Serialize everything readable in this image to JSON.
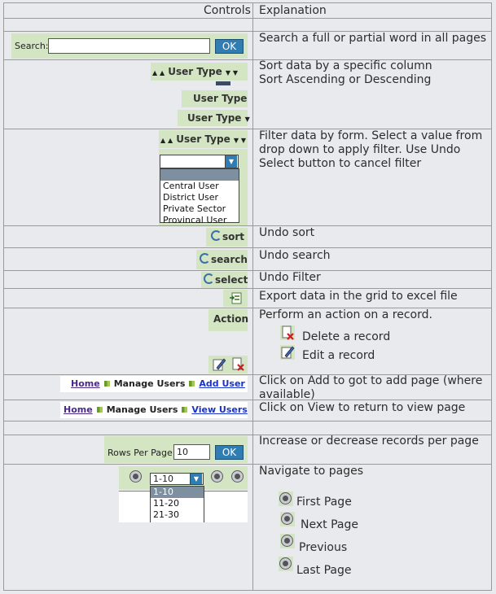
{
  "header": {
    "controls": "Controls",
    "explanation": "Explanation"
  },
  "search": {
    "label": "Search:",
    "value": "",
    "ok": "OK",
    "explanation": "Search a full or partial word in all pages"
  },
  "sort": {
    "column": "User Type",
    "explanation_1": "Sort data by a specific column",
    "explanation_2": "Sort Ascending or Descending"
  },
  "filter": {
    "column": "User Type",
    "selected": "",
    "options": [
      "Central User",
      "District User",
      "Private Sector",
      "Provincal User"
    ],
    "explanation_1": "Filter data by form. Select a value from",
    "explanation_2": "drop down to apply filter. Use Undo",
    "explanation_3": "Select button to cancel filter"
  },
  "undo_sort": {
    "label": "sort",
    "explanation": "Undo sort"
  },
  "undo_search": {
    "label": "search",
    "explanation": "Undo search"
  },
  "undo_filter": {
    "label": "select",
    "explanation": "Undo Filter"
  },
  "export": {
    "icon": "excel-export-icon",
    "explanation": "Export data in the grid to excel file"
  },
  "action": {
    "header": "Action",
    "explanation": "Perform an action on a record.",
    "delete_text": "Delete a record",
    "edit_text": "Edit a record"
  },
  "breadcrumb_add": {
    "home": "Home",
    "current": "Manage Users",
    "link": "Add User",
    "explanation_1": "Click on Add to got to add page (where",
    "explanation_2": "available)"
  },
  "breadcrumb_view": {
    "home": "Home",
    "current": "Manage Users",
    "link": "View Users",
    "explanation": "Click on View to return to view page"
  },
  "rows_per_page": {
    "label": "Rows Per Page:",
    "value": "10",
    "ok": "OK",
    "explanation": "Increase or decrease records per page"
  },
  "pager": {
    "selected": "1-10",
    "options": [
      "1-10",
      "11-20",
      "21-30"
    ],
    "explanation": "Navigate to pages",
    "first": "First Page",
    "next": "Next Page",
    "previous": "Previous",
    "last": "Last Page"
  },
  "colors": {
    "highlight": "#d4e5c4",
    "button": "#2f7db3",
    "background": "#e9eaee",
    "grid": "#9a9a9a"
  }
}
